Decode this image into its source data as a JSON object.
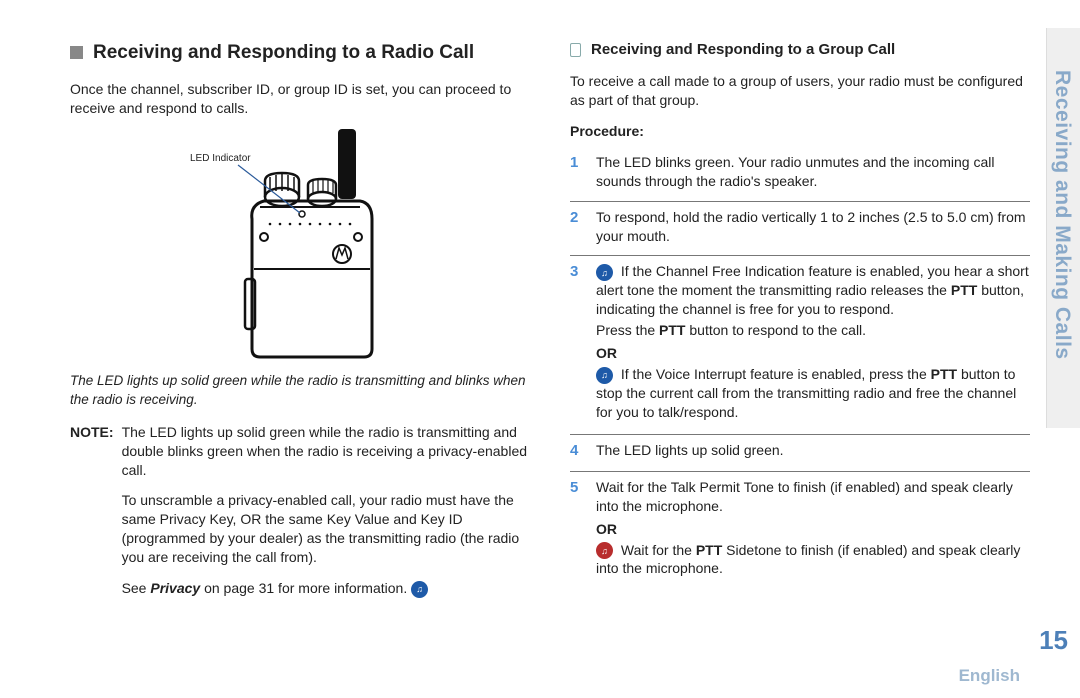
{
  "sideTab": "Receiving and Making Calls",
  "pageNumber": "15",
  "language": "English",
  "left": {
    "heading": "Receiving and Responding to a Radio Call",
    "intro": "Once the channel, subscriber ID, or group ID is set, you can proceed to receive and respond to calls.",
    "ledLabel": "LED Indicator",
    "caption": "The LED lights up solid green while the radio is transmitting and blinks when the radio is receiving.",
    "noteLabel": "NOTE:",
    "noteP1": "The LED lights up solid green while the radio is transmitting and double blinks green when the radio is receiving a privacy-enabled call.",
    "noteP2": "To unscramble a privacy-enabled call, your radio must have the same Privacy Key, OR the same Key Value and Key ID (programmed by your dealer) as the transmitting radio (the radio you are receiving the call from).",
    "noteP3a": "See ",
    "noteP3b": "Privacy",
    "noteP3c": " on page 31 for more information."
  },
  "right": {
    "heading": "Receiving and Responding to a Group Call",
    "intro": "To receive a call made to a group of users, your radio must be configured as part of that group.",
    "procLabel": "Procedure:",
    "steps": {
      "s1": {
        "num": "1",
        "text": "The LED blinks green. Your radio unmutes and the incoming call sounds through the radio's speaker."
      },
      "s2": {
        "num": "2",
        "text": "To respond, hold the radio vertically 1 to 2 inches (2.5 to 5.0 cm) from your mouth."
      },
      "s3": {
        "num": "3",
        "p1a": "If the Channel Free Indication feature is enabled, you hear a short alert tone the moment the transmitting radio releases the ",
        "p1b": "PTT",
        "p1c": " button, indicating the channel is free for you to respond.",
        "p2a": "Press the ",
        "p2b": "PTT",
        "p2c": " button to respond to the call.",
        "or": "OR",
        "p3a": "If the Voice Interrupt feature is enabled, press the ",
        "p3b": "PTT",
        "p3c": " button to stop the current call from the transmitting radio and free the channel for you to talk/respond."
      },
      "s4": {
        "num": "4",
        "text": "The LED lights up solid green."
      },
      "s5": {
        "num": "5",
        "p1": "Wait for the Talk Permit Tone to finish (if enabled) and speak clearly into the microphone.",
        "or": "OR",
        "p2a": "Wait for the ",
        "p2b": "PTT",
        "p2c": " Sidetone to finish (if enabled) and speak clearly into the microphone."
      }
    }
  }
}
